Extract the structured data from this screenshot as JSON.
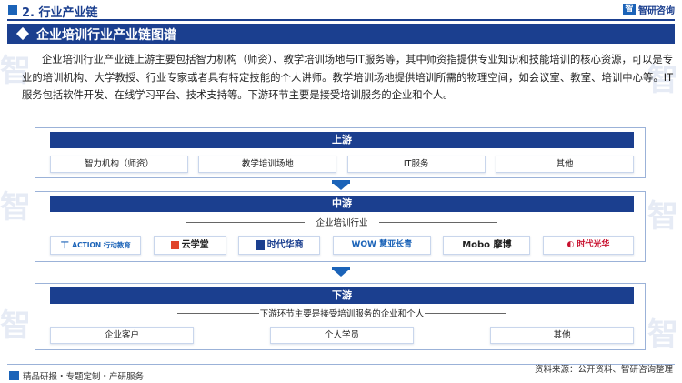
{
  "header": {
    "title": "2. 行业产业链",
    "logo_text": "智研咨询",
    "logo_mark": "智"
  },
  "banner": {
    "title": "企业培训行业产业链图谱"
  },
  "paragraph": "企业培训行业产业链上游主要包括智力机构（师资）、教学培训场地与IT服务等，其中师资指提供专业知识和技能培训的核心资源，可以是专业的培训机构、大学教授、行业专家或者具有特定技能的个人讲师。教学培训场地提供培训所需的物理空间，如会议室、教室、培训中心等。IT服务包括软件开发、在线学习平台、技术支持等。下游环节主要是接受培训服务的企业和个人。",
  "upstream": {
    "title": "上游",
    "items": [
      "智力机构（师资）",
      "教学培训场地",
      "IT服务",
      "其他"
    ]
  },
  "midstream": {
    "title": "中游",
    "subtitle": "企业培训行业",
    "companies": [
      {
        "name": "ACTION 行动教育",
        "icon": "action-logo",
        "color": "#1b63b8"
      },
      {
        "name": "云学堂",
        "icon": "yunxuetang-logo",
        "color": "#e0442a"
      },
      {
        "name": "时代华商",
        "icon": "shidaihuashang-logo",
        "color": "#1b3f8f"
      },
      {
        "name": "WOW 慧亚长青",
        "icon": "wow-logo",
        "color": "#1b63b8"
      },
      {
        "name": "Mobo 摩博",
        "icon": "mobo-logo",
        "color": "#222222"
      },
      {
        "name": "时代光华",
        "icon": "shidaiguanghua-logo",
        "color": "#c8102e"
      }
    ]
  },
  "downstream": {
    "title": "下游",
    "subtitle": "下游环节主要是接受培训服务的企业和个人",
    "items": [
      "企业客户",
      "个人学员",
      "其他"
    ]
  },
  "footer": {
    "left": "精品研报・专题定制・产研服务",
    "right": "资料来源：公开资料、智研咨询整理"
  },
  "colors": {
    "primary": "#1b3f8f",
    "accent": "#1b63b8"
  }
}
